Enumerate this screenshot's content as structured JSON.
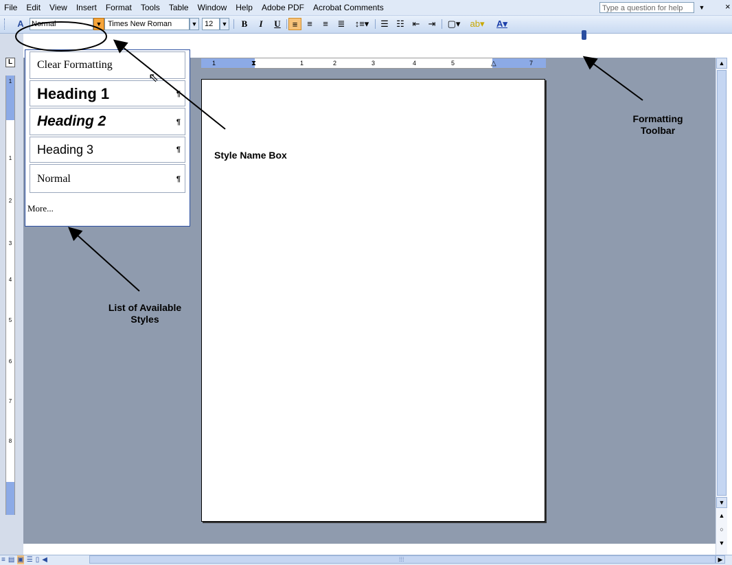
{
  "menubar": {
    "items": [
      "File",
      "Edit",
      "View",
      "Insert",
      "Format",
      "Tools",
      "Table",
      "Window",
      "Help",
      "Adobe PDF",
      "Acrobat Comments"
    ],
    "help_placeholder": "Type a question for help"
  },
  "toolbar": {
    "style_value": "Normal",
    "font_value": "Times New Roman",
    "size_value": "12",
    "bold_label": "B",
    "italic_label": "I",
    "underline_label": "U"
  },
  "style_list": {
    "items": [
      {
        "label": "Clear Formatting",
        "mark": ""
      },
      {
        "label": "Heading 1",
        "mark": "¶"
      },
      {
        "label": "Heading 2",
        "mark": "¶"
      },
      {
        "label": "Heading 3",
        "mark": "¶"
      },
      {
        "label": "Normal",
        "mark": "¶"
      }
    ],
    "more_label": "More..."
  },
  "rulers": {
    "horizontal_numbers": [
      "1",
      "1",
      "2",
      "3",
      "4",
      "5",
      "7"
    ],
    "vertical_numbers": [
      "1",
      "1",
      "2",
      "3",
      "4",
      "5",
      "6",
      "7",
      "8"
    ]
  },
  "annotations": {
    "style_name_box": "Style Name Box",
    "formatting_toolbar": "Formatting Toolbar",
    "list_of_styles": "List of Available Styles"
  }
}
